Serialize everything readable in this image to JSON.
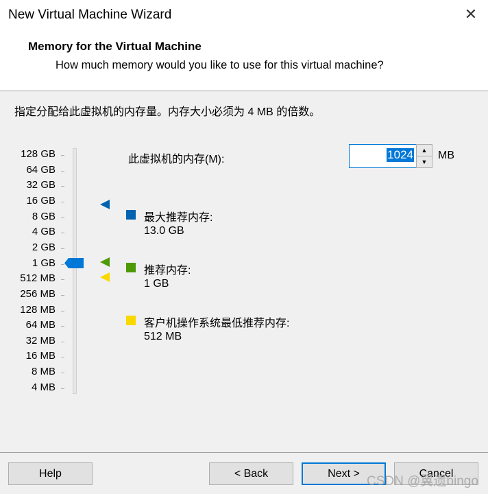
{
  "window": {
    "title": "New Virtual Machine Wizard",
    "close_icon": "close-icon"
  },
  "header": {
    "heading": "Memory for the Virtual Machine",
    "subheading": "How much memory would you like to use for this virtual machine?"
  },
  "instruction": "指定分配给此虚拟机的内存量。内存大小必须为 4 MB 的倍数。",
  "scale": {
    "labels": [
      "128 GB",
      "64 GB",
      "32 GB",
      "16 GB",
      "8 GB",
      "4 GB",
      "2 GB",
      "1 GB",
      "512 MB",
      "256 MB",
      "128 MB",
      "64 MB",
      "32 MB",
      "16 MB",
      "8 MB",
      "4 MB"
    ],
    "selected": "1 GB"
  },
  "memory": {
    "label": "此虚拟机的内存(M):",
    "value": "1024",
    "unit": "MB"
  },
  "legend": [
    {
      "title": "最大推荐内存:",
      "value": "13.0 GB",
      "color": "#0063b1"
    },
    {
      "title": "推荐内存:",
      "value": "1 GB",
      "color": "#4e9a06"
    },
    {
      "title": "客户机操作系统最低推荐内存:",
      "value": "512 MB",
      "color": "#f9d800"
    }
  ],
  "buttons": {
    "help": "Help",
    "back": "< Back",
    "next": "Next >",
    "cancel": "Cancel"
  },
  "watermark": "CSDN @翼遗bingo"
}
